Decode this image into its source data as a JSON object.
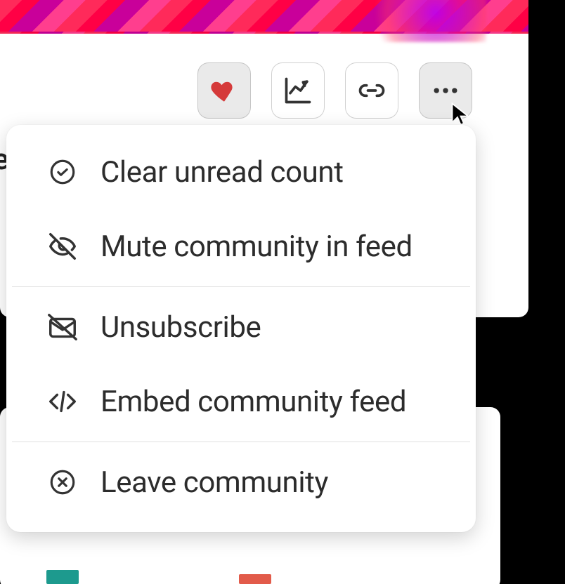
{
  "edge_text_fragment": "e",
  "actions": {
    "favorite": {
      "selected": true
    },
    "analytics": {},
    "link": {},
    "more": {
      "open": true
    }
  },
  "menu": {
    "items": [
      {
        "id": "clear-unread",
        "label": "Clear unread count",
        "icon": "check-circle-icon"
      },
      {
        "id": "mute",
        "label": "Mute community in feed",
        "icon": "eye-off-icon"
      },
      {
        "id": "unsubscribe",
        "label": "Unsubscribe",
        "icon": "mail-off-icon"
      },
      {
        "id": "embed",
        "label": "Embed community feed",
        "icon": "code-icon"
      },
      {
        "id": "leave",
        "label": "Leave community",
        "icon": "close-circle-icon"
      }
    ]
  }
}
